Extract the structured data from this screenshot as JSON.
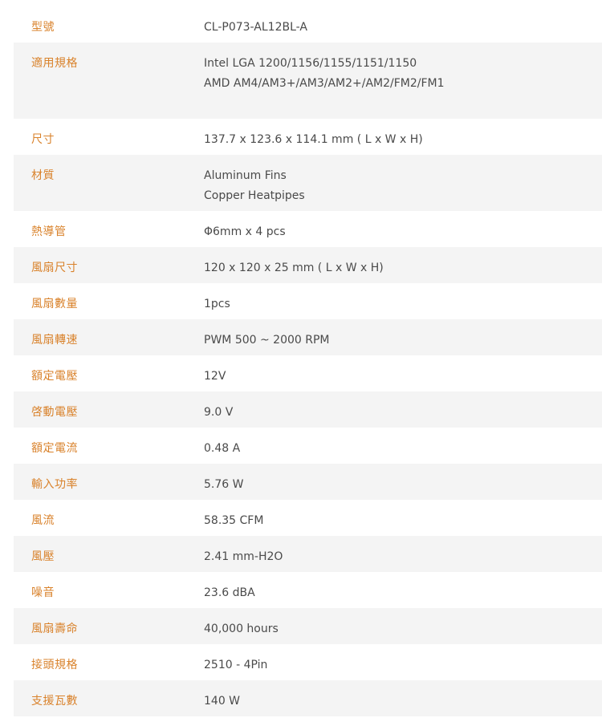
{
  "specs": [
    {
      "label": "型號",
      "lines": [
        "CL-P073-AL12BL-A"
      ]
    },
    {
      "label": "適用規格",
      "lines": [
        "Intel LGA 1200/1156/1155/1151/1150",
        "AMD AM4/AM3+/AM3/AM2+/AM2/FM2/FM1"
      ]
    },
    {
      "label": "尺寸",
      "lines": [
        "137.7 x 123.6 x 114.1 mm ( L x W x H)"
      ]
    },
    {
      "label": "材質",
      "lines": [
        "Aluminum Fins",
        "Copper Heatpipes"
      ]
    },
    {
      "label": "熱導管",
      "lines": [
        "Φ6mm x 4 pcs"
      ]
    },
    {
      "label": "風扇尺寸",
      "lines": [
        "120 x 120 x 25 mm ( L x W x H)"
      ]
    },
    {
      "label": "風扇數量",
      "lines": [
        "1pcs"
      ]
    },
    {
      "label": "風扇轉速",
      "lines": [
        "PWM 500 ~ 2000 RPM"
      ]
    },
    {
      "label": "額定電壓",
      "lines": [
        "12V"
      ]
    },
    {
      "label": "啓動電壓",
      "lines": [
        "9.0 V"
      ]
    },
    {
      "label": "額定電流",
      "lines": [
        "0.48 A"
      ]
    },
    {
      "label": "輸入功率",
      "lines": [
        "5.76 W"
      ]
    },
    {
      "label": "風流",
      "lines": [
        "58.35 CFM"
      ]
    },
    {
      "label": "風壓",
      "lines": [
        "2.41 mm-H2O"
      ]
    },
    {
      "label": "噪音",
      "lines": [
        "23.6 dBA"
      ]
    },
    {
      "label": "風扇壽命",
      "lines": [
        "40,000 hours"
      ]
    },
    {
      "label": "接頭規格",
      "lines": [
        "2510 - 4Pin"
      ]
    },
    {
      "label": "支援瓦數",
      "lines": [
        "140 W"
      ]
    }
  ],
  "colors": {
    "label": "#d9822b",
    "value": "#4a4a4a",
    "row_shade": "#f4f4f4"
  }
}
